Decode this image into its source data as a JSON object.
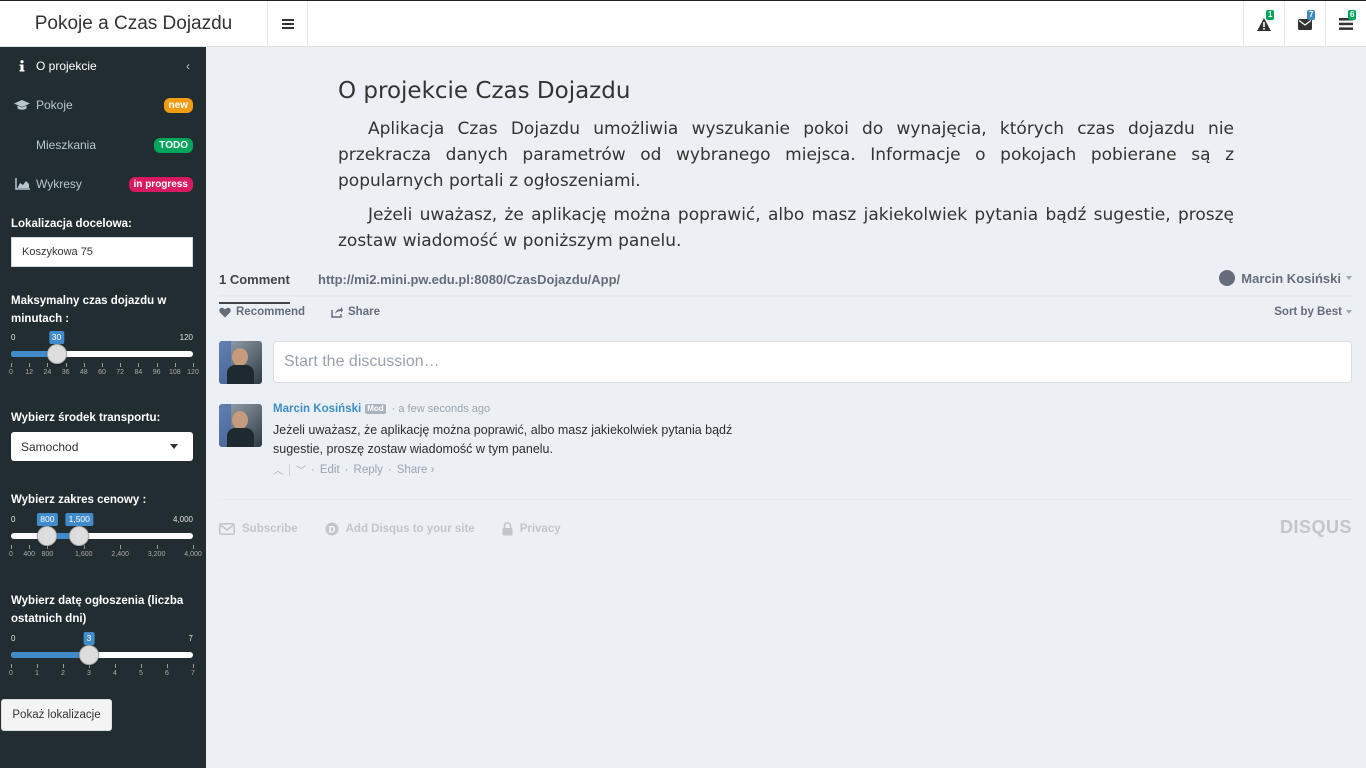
{
  "app": {
    "title": "Pokoje a Czas Dojazdu"
  },
  "header": {
    "notifications": [
      {
        "icon": "warning-icon",
        "count": "1"
      },
      {
        "icon": "envelope-icon",
        "count": "7"
      },
      {
        "icon": "tasks-icon",
        "count": "6"
      }
    ]
  },
  "sidebar": {
    "menu": [
      {
        "label": "O projekcie",
        "icon": "info-icon"
      },
      {
        "label": "Pokoje",
        "icon": "graduation-cap-icon",
        "badge": "new"
      },
      {
        "label": "Mieszkania",
        "badge": "TODO"
      },
      {
        "label": "Wykresy",
        "icon": "area-chart-icon",
        "badge": "in progress"
      }
    ],
    "location": {
      "label": "Lokalizacja docelowa:",
      "value": "Koszykowa 75"
    },
    "time_slider": {
      "label": "Maksymalny czas dojazdu w minutach :",
      "min": "0",
      "max": "120",
      "value": "30",
      "value_num": 30,
      "min_num": 0,
      "max_num": 120,
      "ticks": [
        "0",
        "12",
        "24",
        "36",
        "48",
        "60",
        "72",
        "84",
        "96",
        "108",
        "120"
      ]
    },
    "transport": {
      "label": "Wybierz środek transportu:",
      "value": "Samochod"
    },
    "price_slider": {
      "label": "Wybierz zakres cenowy :",
      "min": "0",
      "max": "4,000",
      "from": "800",
      "to": "1,500",
      "from_num": 800,
      "to_num": 1500,
      "min_num": 0,
      "max_num": 4000,
      "ticks": [
        "0",
        "400",
        "800",
        "1,600",
        "2,400",
        "3,200",
        "4,000"
      ]
    },
    "date_slider": {
      "label": "Wybierz datę ogłoszenia (liczba ostatnich dni)",
      "min": "0",
      "max": "7",
      "value": "3",
      "value_num": 3,
      "min_num": 0,
      "max_num": 7,
      "ticks": [
        "0",
        "1",
        "2",
        "3",
        "4",
        "5",
        "6",
        "7"
      ]
    },
    "button": "Pokaż lokalizacje"
  },
  "main": {
    "title": "O projekcie Czas Dojazdu",
    "paragraphs": [
      "Aplikacja Czas Dojazdu umożliwia wyszukanie pokoi do wynajęcia, których czas dojazdu nie przekracza danych parametrów od wybranego miejsca. Informacje o pokojach pobierane są z popularnych portali z ogłoszeniami.",
      "Jeżeli uważasz, że aplikację można poprawić, albo masz jakiekolwiek pytania bądź sugestie, proszę zostaw wiadomość w poniższym panelu."
    ]
  },
  "disqus": {
    "comment_count": "1 Comment",
    "url": "http://mi2.mini.pw.edu.pl:8080/CzasDojazdu/App/",
    "user": "Marcin Kosiński",
    "recommend": "Recommend",
    "share": "Share",
    "sort": "Sort by Best",
    "placeholder": "Start the discussion…",
    "comment": {
      "author": "Marcin Kosiński",
      "badge": "Mod",
      "time": "a few seconds ago",
      "text": "Jeżeli uważasz, że aplikację można poprawić, albo masz jakiekolwiek pytania bądź sugestie, proszę zostaw wiadomość w tym panelu.",
      "edit": "Edit",
      "reply": "Reply",
      "share": "Share ›"
    },
    "footer": {
      "subscribe": "Subscribe",
      "add": "Add Disqus to your site",
      "privacy": "Privacy",
      "logo": "DISQUS"
    }
  }
}
